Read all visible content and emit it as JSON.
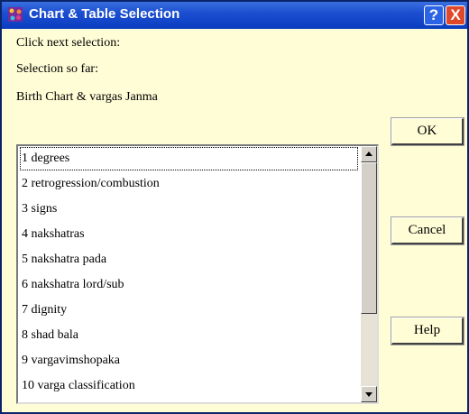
{
  "window": {
    "title": "Chart & Table Selection",
    "help_glyph": "?",
    "close_glyph": "X"
  },
  "labels": {
    "prompt": "Click next selection:",
    "selection_heading": "Selection so far:",
    "selection_value": "Birth Chart & vargas Janma"
  },
  "list": {
    "selected_index": 0,
    "items": [
      "1 degrees",
      "2 retrogression/combustion",
      "3 signs",
      "4 nakshatras",
      "5 nakshatra pada",
      "6 nakshatra lord/sub",
      "7 dignity",
      "8 shad bala",
      "9 vargavimshopaka",
      "10 varga classification"
    ]
  },
  "buttons": {
    "ok": "OK",
    "cancel": "Cancel",
    "help": "Help"
  },
  "colors": {
    "dialog_background": "#fffdd6",
    "titlebar": "#1c4fd0",
    "close_button": "#e0482a"
  },
  "icons": {
    "app": "app-icon",
    "scroll_up": "scroll-up-arrow-icon",
    "scroll_down": "scroll-down-arrow-icon"
  }
}
